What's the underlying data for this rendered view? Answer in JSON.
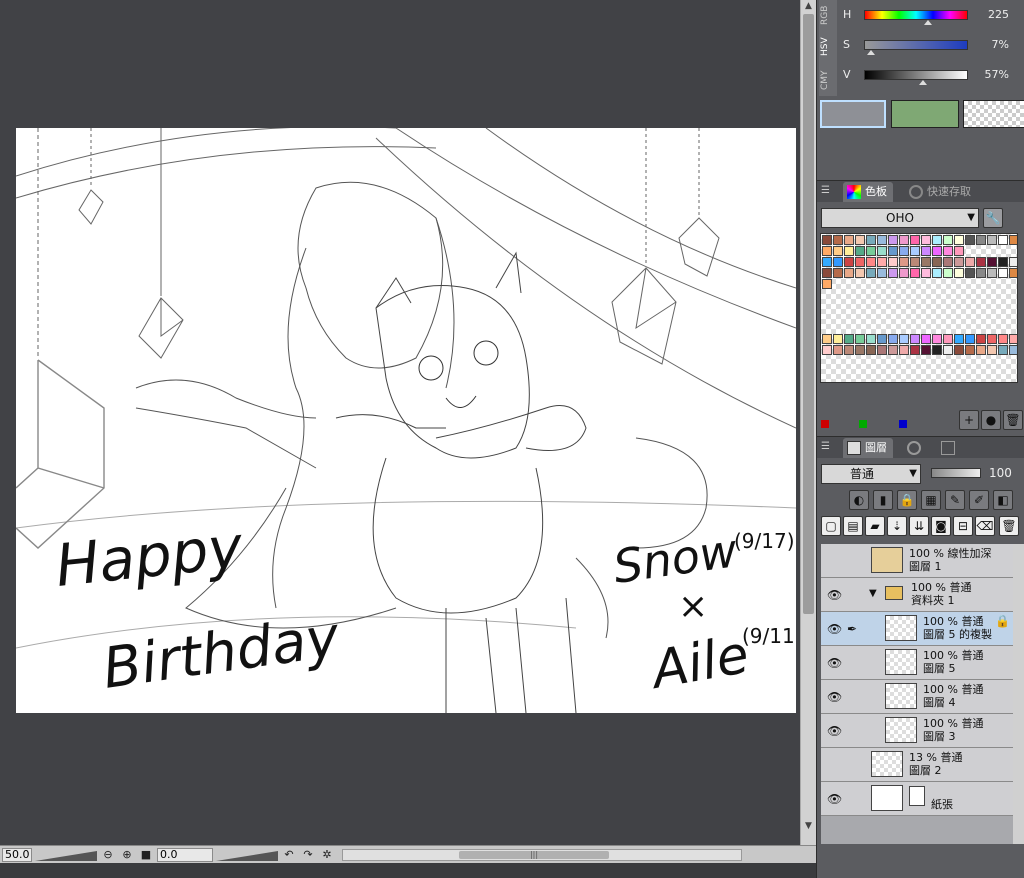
{
  "statusbar": {
    "zoom": "50.0",
    "rotation": "0.0"
  },
  "color_slider": {
    "tabs": [
      "RGB",
      "HSV",
      "CMY"
    ],
    "rows": [
      {
        "label": "H",
        "value": "225",
        "level": 0.62
      },
      {
        "label": "S",
        "value": "7%",
        "level": 0.07
      },
      {
        "label": "V",
        "value": "57%",
        "level": 0.57
      }
    ],
    "swatches": {
      "main": "#8e9096",
      "sub": "#7fa874"
    }
  },
  "palette_panel": {
    "tabs": [
      "色板",
      "快速存取"
    ],
    "set_name": "OHO"
  },
  "layer_panel": {
    "tab": "圖層",
    "blend_mode": "普通",
    "opacity": "100",
    "layers": [
      {
        "line1": "100 % 線性加深",
        "line2": "圖層 1",
        "visible": false,
        "thumb": "#e6cf9a"
      },
      {
        "line1": "100 % 普通",
        "line2": "資料夾 1",
        "visible": true,
        "folder": true
      },
      {
        "line1": "100 % 普通",
        "line2": "圖層 5 的複製",
        "visible": true,
        "selected": true,
        "locked": true
      },
      {
        "line1": "100 % 普通",
        "line2": "圖層 5",
        "visible": true
      },
      {
        "line1": "100 % 普通",
        "line2": "圖層 4",
        "visible": true
      },
      {
        "line1": "100 % 普通",
        "line2": "圖層 3",
        "visible": true
      },
      {
        "line1": "13 % 普通",
        "line2": "圖層 2",
        "visible": false
      },
      {
        "line1": "",
        "line2": "紙張",
        "visible": true,
        "paper": true
      }
    ]
  },
  "artwork": {
    "text_happy": "Happy",
    "text_birthday": "Birthday",
    "text_snow": "Snow",
    "text_snow_date": "(9/17)",
    "text_x": "×",
    "text_aile": "Aile",
    "text_aile_date": "(9/11)"
  }
}
